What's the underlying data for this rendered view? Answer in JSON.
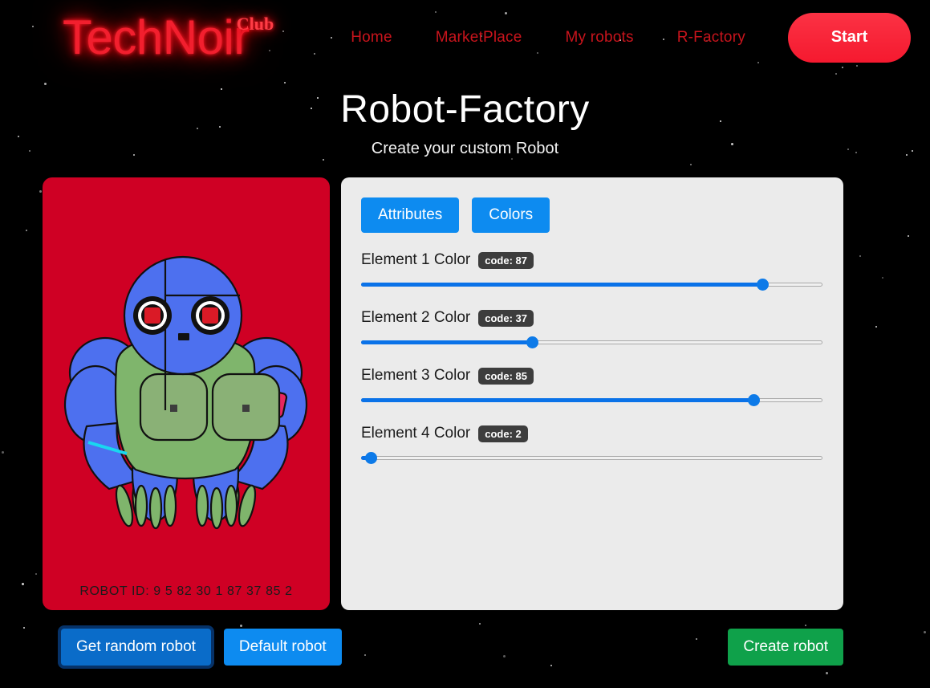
{
  "header": {
    "logo_main": "TechNoir",
    "logo_sup": "Club",
    "nav": [
      {
        "label": "Home"
      },
      {
        "label": "MarketPlace"
      },
      {
        "label": "My robots"
      },
      {
        "label": "R-Factory"
      }
    ],
    "start_label": "Start",
    "nav_color": "#c8141c",
    "logo_color": "#f21f2e",
    "start_color": "#f5192f"
  },
  "page": {
    "title": "Robot-Factory",
    "subtitle": "Create your custom Robot"
  },
  "preview": {
    "robot_id": "ROBOT ID: 9 5 82 30 1 87 37 85 2",
    "card_color": "#cf0024",
    "robot_colors": {
      "head": "#4d70ef",
      "body": "#7fb56c",
      "limbs": "#4d70ef",
      "digits": "#7fb56c",
      "eye_pupil": "#da1a26",
      "accent_pink": "#e8275e",
      "accent_cyan": "#19d7f0",
      "outline": "#111111"
    }
  },
  "panel": {
    "tabs": [
      {
        "label": "Attributes",
        "name": "tab-attributes",
        "active": false
      },
      {
        "label": "Colors",
        "name": "tab-colors",
        "active": true
      }
    ],
    "tab_color": "#0d8bf0",
    "sliders": [
      {
        "label": "Element 1 Color",
        "badge": "code: 87",
        "value": 87,
        "min": 0,
        "max": 100
      },
      {
        "label": "Element 2 Color",
        "badge": "code: 37",
        "value": 37,
        "min": 0,
        "max": 100
      },
      {
        "label": "Element 3 Color",
        "badge": "code: 85",
        "value": 85,
        "min": 0,
        "max": 100
      },
      {
        "label": "Element 4 Color",
        "badge": "code: 2",
        "value": 2,
        "min": 0,
        "max": 100
      }
    ]
  },
  "footer": {
    "random_label": "Get random robot",
    "default_label": "Default robot",
    "create_label": "Create robot",
    "create_color": "#0fa14a"
  }
}
